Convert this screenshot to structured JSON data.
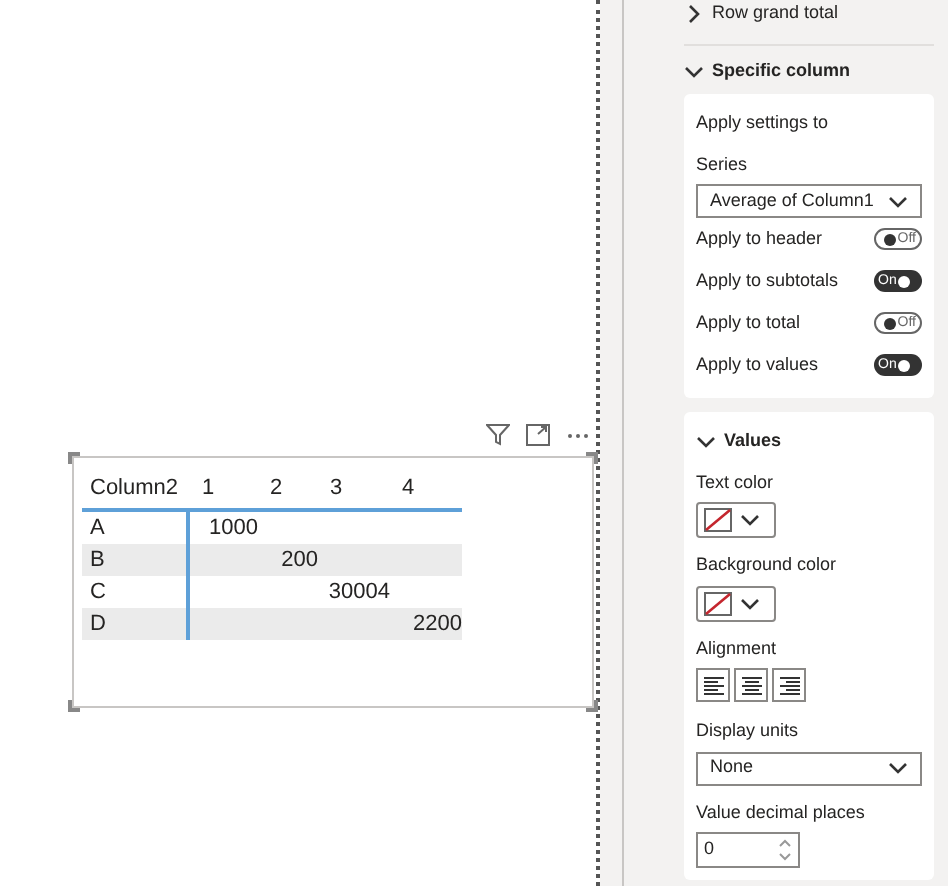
{
  "visual": {
    "header": "Column2",
    "columns": [
      "1",
      "2",
      "3",
      "4"
    ],
    "rows": [
      {
        "label": "A",
        "cells": [
          "1000",
          null,
          null,
          null
        ]
      },
      {
        "label": "B",
        "cells": [
          null,
          "200",
          null,
          null
        ]
      },
      {
        "label": "C",
        "cells": [
          null,
          null,
          "30004",
          null
        ]
      },
      {
        "label": "D",
        "cells": [
          null,
          null,
          null,
          "2200"
        ]
      }
    ]
  },
  "pane": {
    "collapsed_section": {
      "label": "Row grand total",
      "expanded": false
    },
    "specific_column": {
      "label": "Specific column",
      "expanded": true,
      "heading": "Apply settings to",
      "series_label": "Series",
      "series_value": "Average of Column1",
      "toggles": [
        {
          "label": "Apply to header",
          "on": false,
          "text": "Off"
        },
        {
          "label": "Apply to subtotals",
          "on": true,
          "text": "On"
        },
        {
          "label": "Apply to total",
          "on": false,
          "text": "Off"
        },
        {
          "label": "Apply to values",
          "on": true,
          "text": "On"
        }
      ]
    },
    "values": {
      "label": "Values",
      "expanded": true,
      "text_color_label": "Text color",
      "background_color_label": "Background color",
      "alignment_label": "Alignment",
      "display_units_label": "Display units",
      "display_units_value": "None",
      "decimal_label": "Value decimal places",
      "decimal_value": "0"
    }
  }
}
